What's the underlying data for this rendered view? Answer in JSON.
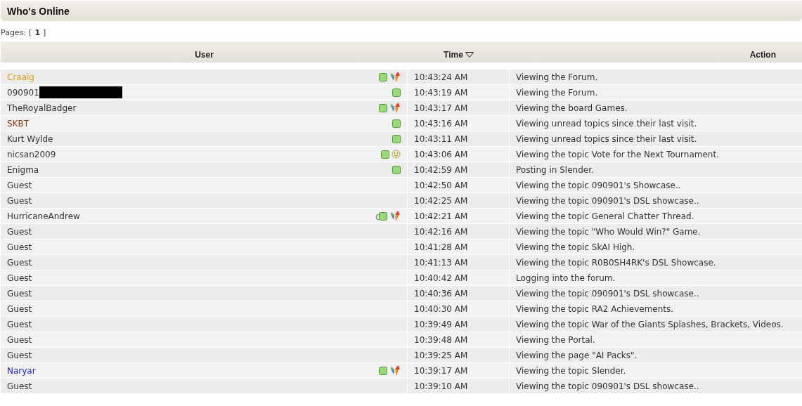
{
  "title": "Who's Online",
  "pages": {
    "label": "Pages:",
    "open": "[",
    "current": "1",
    "close": "]"
  },
  "columns": [
    {
      "label": "User",
      "sorted": false
    },
    {
      "label": "Time",
      "sorted": true
    },
    {
      "label": "Action",
      "sorted": false
    }
  ],
  "rows": [
    {
      "user": "Craaig",
      "color": "#d4a017",
      "redacted": false,
      "icons": [
        {
          "kind": "online"
        },
        {
          "kind": "butterfly"
        }
      ],
      "time": "10:43:24 AM",
      "action": "Viewing the Forum."
    },
    {
      "user": "090901",
      "color": "#333333",
      "redacted": true,
      "icons": [
        {
          "kind": "online"
        }
      ],
      "time": "10:43:19 AM",
      "action": "Viewing the Forum."
    },
    {
      "user": "TheRoyalBadger",
      "color": "#333333",
      "redacted": false,
      "icons": [
        {
          "kind": "online"
        },
        {
          "kind": "butterfly"
        }
      ],
      "time": "10:43:17 AM",
      "action": "Viewing the board Games."
    },
    {
      "user": "SKBT",
      "color": "#8b3a0e",
      "redacted": false,
      "icons": [
        {
          "kind": "online"
        }
      ],
      "time": "10:43:16 AM",
      "action": "Viewing unread topics since their last visit."
    },
    {
      "user": "Kurt Wylde",
      "color": "#333333",
      "redacted": false,
      "icons": [
        {
          "kind": "online"
        }
      ],
      "time": "10:43:11 AM",
      "action": "Viewing unread topics since their last visit."
    },
    {
      "user": "nicsan2009",
      "color": "#333333",
      "redacted": false,
      "icons": [
        {
          "kind": "online"
        },
        {
          "kind": "smiley"
        }
      ],
      "time": "10:43:06 AM",
      "action": "Viewing the topic Vote for the Next Tournament."
    },
    {
      "user": "Enigma",
      "color": "#333333",
      "redacted": false,
      "icons": [
        {
          "kind": "online"
        }
      ],
      "time": "10:42:59 AM",
      "action": "Posting in Slender."
    },
    {
      "user": "Guest",
      "color": "#333333",
      "redacted": false,
      "icons": [],
      "time": "10:42:50 AM",
      "action": "Viewing the topic 090901's Showcase.."
    },
    {
      "user": "Guest",
      "color": "#333333",
      "redacted": false,
      "icons": [],
      "time": "10:42:25 AM",
      "action": "Viewing the topic 090901's DSL showcase.."
    },
    {
      "user": "HurricaneAndrew",
      "color": "#333333",
      "redacted": false,
      "icons": [
        {
          "kind": "stacked"
        },
        {
          "kind": "butterfly"
        }
      ],
      "time": "10:42:21 AM",
      "action": "Viewing the topic General Chatter Thread."
    },
    {
      "user": "Guest",
      "color": "#333333",
      "redacted": false,
      "icons": [],
      "time": "10:42:16 AM",
      "action": "Viewing the topic \"Who Would Win?\" Game."
    },
    {
      "user": "Guest",
      "color": "#333333",
      "redacted": false,
      "icons": [],
      "time": "10:41:28 AM",
      "action": "Viewing the topic SkAI High."
    },
    {
      "user": "Guest",
      "color": "#333333",
      "redacted": false,
      "icons": [],
      "time": "10:41:13 AM",
      "action": "Viewing the topic R0B0SH4RK's DSL Showcase."
    },
    {
      "user": "Guest",
      "color": "#333333",
      "redacted": false,
      "icons": [],
      "time": "10:40:42 AM",
      "action": "Logging into the forum."
    },
    {
      "user": "Guest",
      "color": "#333333",
      "redacted": false,
      "icons": [],
      "time": "10:40:36 AM",
      "action": "Viewing the topic 090901's DSL showcase.."
    },
    {
      "user": "Guest",
      "color": "#333333",
      "redacted": false,
      "icons": [],
      "time": "10:40:30 AM",
      "action": "Viewing the topic RA2 Achievements."
    },
    {
      "user": "Guest",
      "color": "#333333",
      "redacted": false,
      "icons": [],
      "time": "10:39:49 AM",
      "action": "Viewing the topic War of the Giants Splashes, Brackets, Videos."
    },
    {
      "user": "Guest",
      "color": "#333333",
      "redacted": false,
      "icons": [],
      "time": "10:39:48 AM",
      "action": "Viewing the Portal."
    },
    {
      "user": "Guest",
      "color": "#333333",
      "redacted": false,
      "icons": [],
      "time": "10:39:25 AM",
      "action": "Viewing the page \"AI Packs\"."
    },
    {
      "user": "Naryar",
      "color": "#1a1acc",
      "redacted": false,
      "icons": [
        {
          "kind": "online"
        },
        {
          "kind": "butterfly"
        }
      ],
      "time": "10:39:17 AM",
      "action": "Viewing the topic Slender."
    },
    {
      "user": "Guest",
      "color": "#333333",
      "redacted": false,
      "icons": [],
      "time": "10:39:10 AM",
      "action": "Viewing the topic 090901's DSL showcase.."
    }
  ]
}
